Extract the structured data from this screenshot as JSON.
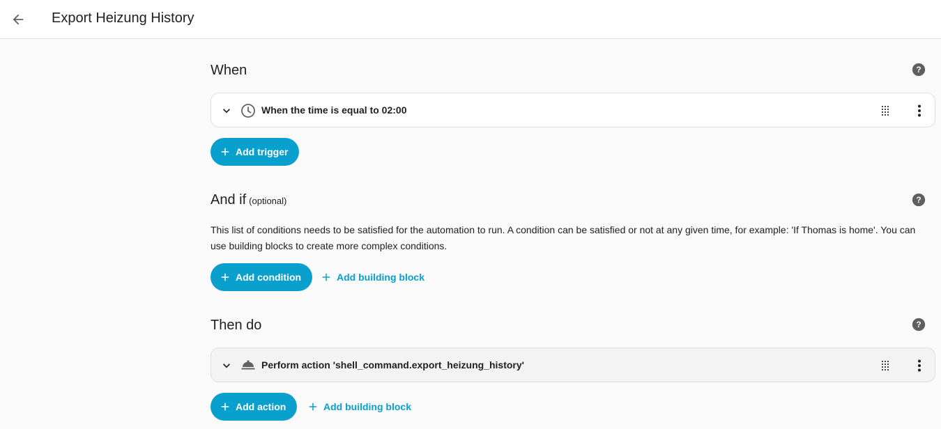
{
  "header": {
    "title": "Export Heizung History",
    "back_icon": "arrow-left-icon"
  },
  "when": {
    "title": "When",
    "trigger": {
      "label": "When the time is equal to 02:00",
      "icon": "clock-icon"
    },
    "add_trigger_label": "Add trigger"
  },
  "and_if": {
    "title": "And if",
    "optional": "(optional)",
    "description": "This list of conditions needs to be satisfied for the automation to run. A condition can be satisfied or not at any given time, for example: 'If Thomas is home'. You can use building blocks to create more complex conditions.",
    "add_condition_label": "Add condition",
    "add_building_block_label": "Add building block"
  },
  "then_do": {
    "title": "Then do",
    "action": {
      "label": "Perform action 'shell_command.export_heizung_history'",
      "icon": "room-service-icon"
    },
    "add_action_label": "Add action",
    "add_building_block_label": "Add building block"
  },
  "colors": {
    "accent": "#0aa0cd",
    "background": "#fafafa",
    "card": "#ffffff",
    "action_card": "#f3f3f3",
    "help_icon": "#5f5f5f"
  }
}
